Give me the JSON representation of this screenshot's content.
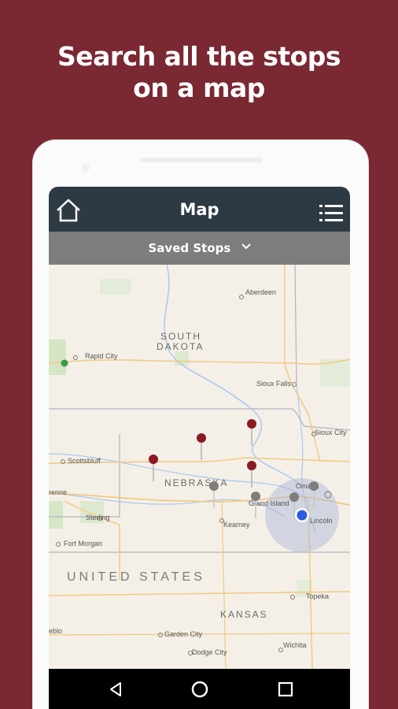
{
  "headline": [
    "Search all the stops",
    "on a map"
  ],
  "appbar": {
    "title": "Map"
  },
  "filter": {
    "selected": "Saved Stops"
  },
  "map": {
    "states": [
      "SOUTH",
      "DAKOTA",
      "NEBRASKA",
      "KANSAS"
    ],
    "country": "UNITED STATES",
    "cities": [
      "Aberdeen",
      "Rapid City",
      "Sioux Falls",
      "Sioux City",
      "Scottsbluff",
      "Omaha",
      "Grand Island",
      "Lincoln",
      "Kearney",
      "Sterling",
      "Fort Morgan",
      "Topeka",
      "Garden City",
      "Dodge City",
      "Wichita",
      "renne",
      "eblo"
    ]
  },
  "colors": {
    "brand": "#7a2832",
    "appbar": "#2d3a44",
    "pin_saved": "#8b1a24",
    "pin_other": "#7d7d7d",
    "location": "#2a5de0"
  }
}
